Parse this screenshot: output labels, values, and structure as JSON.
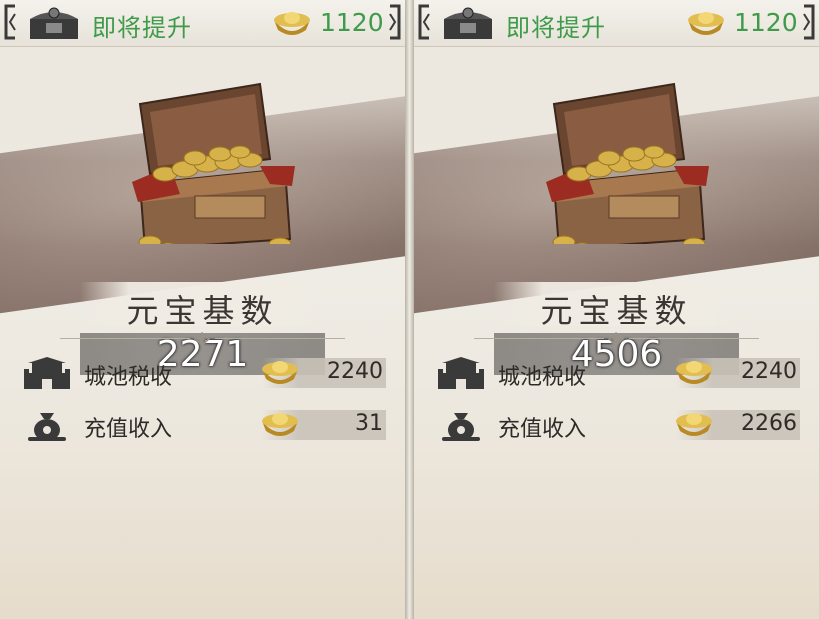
{
  "panels": [
    {
      "header": {
        "title": "即将提升",
        "gold": "1120"
      },
      "scene": {
        "title": "元宝基数",
        "value": "2271"
      },
      "rows": [
        {
          "label": "城池税收",
          "value": "2240"
        },
        {
          "label": "充值收入",
          "value": "31"
        }
      ]
    },
    {
      "header": {
        "title": "即将提升",
        "gold": "1120"
      },
      "scene": {
        "title": "元宝基数",
        "value": "4506"
      },
      "rows": [
        {
          "label": "城池税收",
          "value": "2240"
        },
        {
          "label": "充值收入",
          "value": "2266"
        }
      ]
    }
  ],
  "icons": {
    "header_chest": "treasure-chest-icon",
    "gold": "gold-ingot-icon",
    "row1": "city-wall-icon",
    "row2": "money-bag-icon"
  },
  "colors": {
    "accent_green": "#3f9a4a",
    "gold": "#c9a13a"
  }
}
